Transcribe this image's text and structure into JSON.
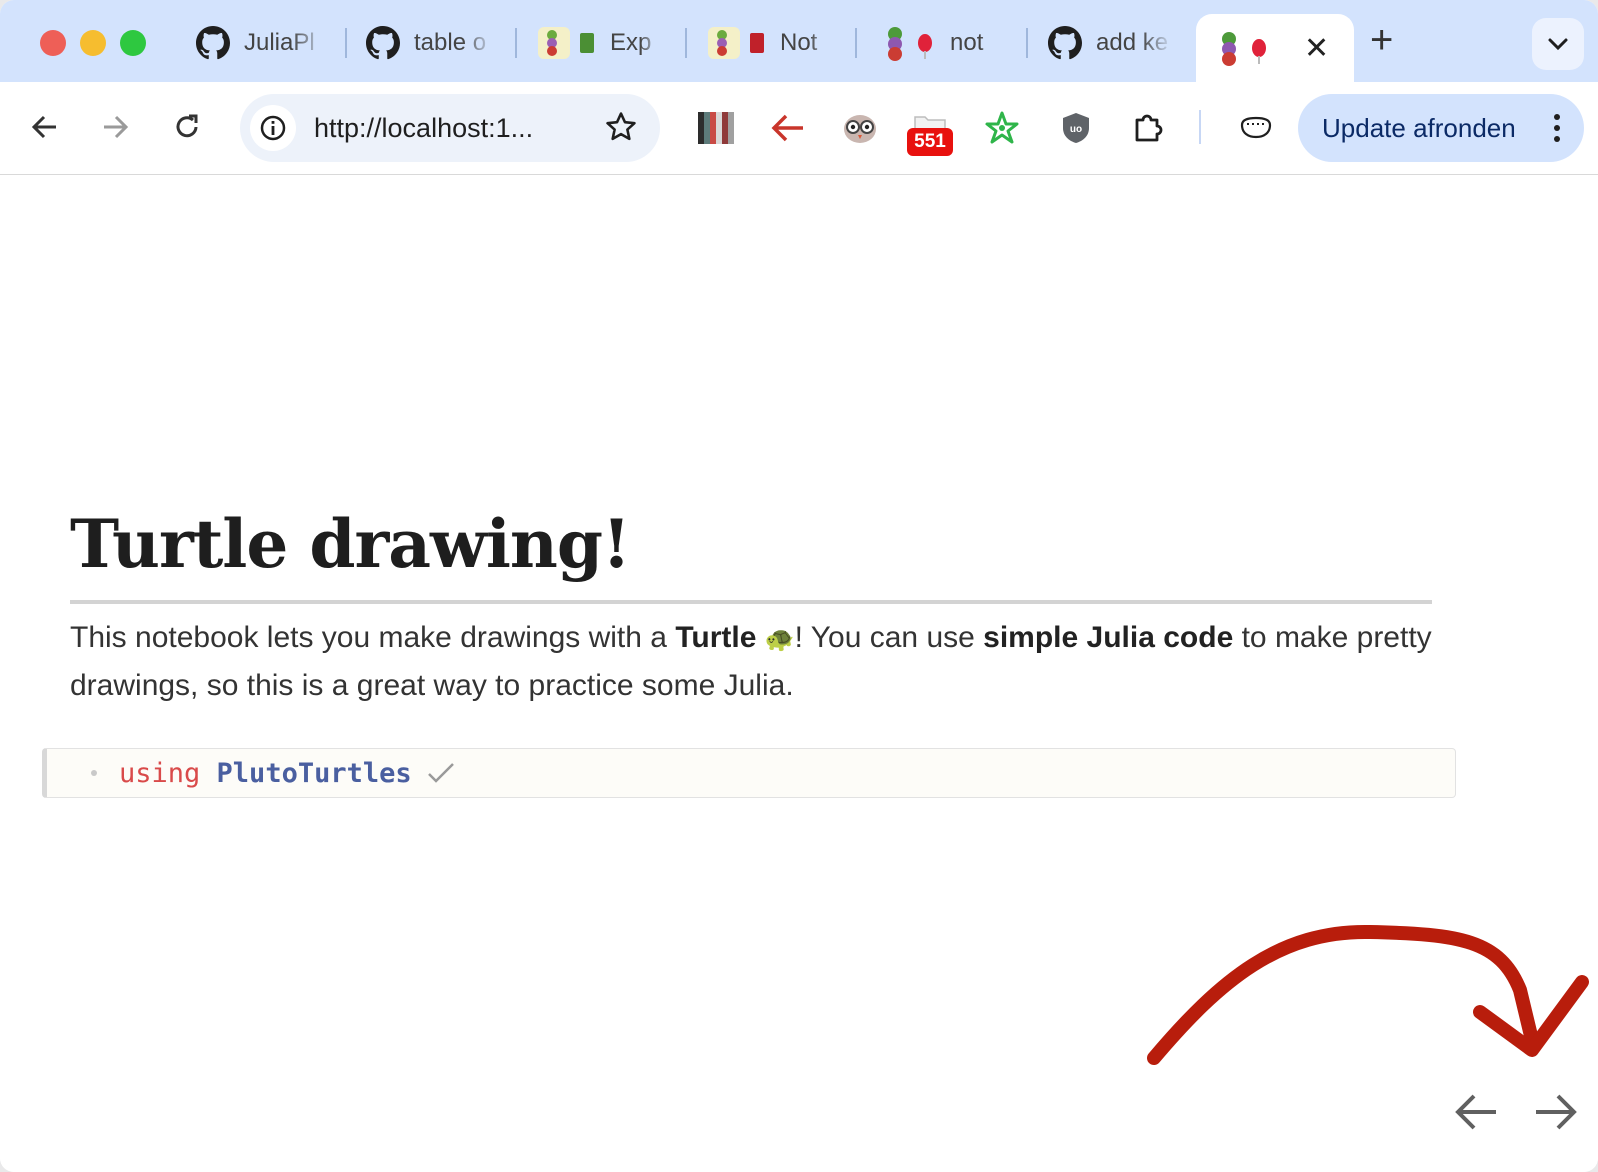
{
  "browser": {
    "tabs": [
      {
        "label": "JuliaPl",
        "icon": "github-icon"
      },
      {
        "label": "table o",
        "icon": "github-icon"
      },
      {
        "label": "Exp",
        "icon": "pluto-icon",
        "emoji": "green-book-icon"
      },
      {
        "label": "Not",
        "icon": "pluto-icon",
        "emoji": "red-book-icon"
      },
      {
        "label": "not",
        "icon": "pluto-icon",
        "emoji": "balloon-icon"
      },
      {
        "label": "add ke",
        "icon": "github-icon"
      },
      {
        "label": "",
        "icon": "pluto-icon",
        "emoji": "balloon-icon",
        "active": true
      }
    ],
    "url": "http://localhost:1...",
    "extension_badge": "551",
    "update_button": "Update afronden"
  },
  "notebook": {
    "title": "Turtle drawing!",
    "intro": {
      "p1": "This notebook lets you make drawings with a ",
      "b1": "Turtle",
      "emoji": "🐢",
      "p2": "! You can use ",
      "b2": "simple Julia code",
      "p3": " to make pretty drawings, so this is a great way to practice some Julia."
    },
    "cell": {
      "keyword": "using",
      "module": "PlutoTurtles"
    }
  },
  "colors": {
    "tabstrip": "#d3e3fd",
    "annotation_arrow": "#b81d0c",
    "keyword": "#d94a4a",
    "module": "#4a5fa0"
  }
}
